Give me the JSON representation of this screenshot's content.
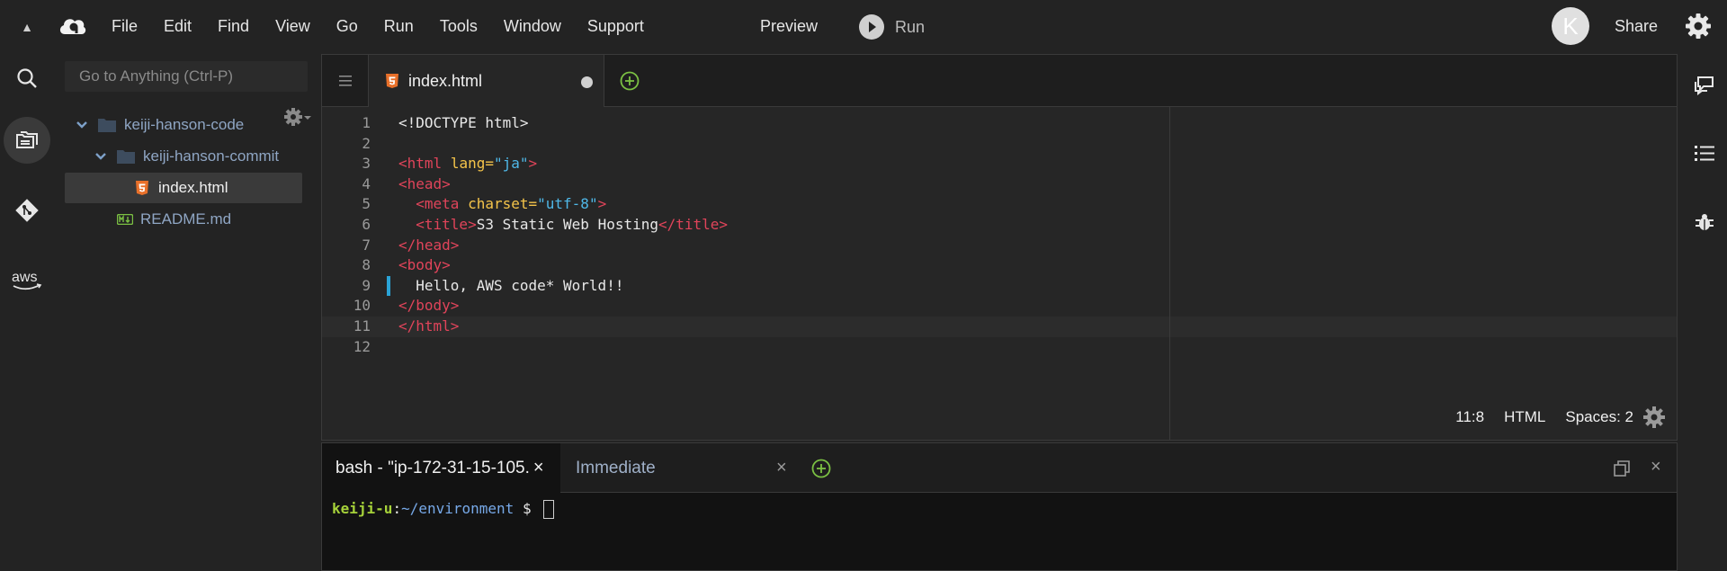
{
  "menubar": {
    "items": [
      "File",
      "Edit",
      "Find",
      "View",
      "Go",
      "Run",
      "Tools",
      "Window",
      "Support"
    ],
    "preview_label": "Preview",
    "run_label": "Run",
    "avatar_initial": "K",
    "share_label": "Share"
  },
  "tree": {
    "search_placeholder": "Go to Anything (Ctrl-P)",
    "nodes": [
      {
        "label": "keiji-hanson-code"
      },
      {
        "label": "keiji-hanson-commit"
      },
      {
        "label": "index.html"
      },
      {
        "label": "README.md"
      }
    ]
  },
  "editor": {
    "tab_name": "index.html",
    "status": {
      "position": "11:8",
      "mode": "HTML",
      "spaces": "Spaces: 2"
    },
    "lines": [
      "1",
      "2",
      "3",
      "4",
      "5",
      "6",
      "7",
      "8",
      "9",
      "10",
      "11",
      "12"
    ],
    "code": {
      "doctype": "<!DOCTYPE html>",
      "html_open": "<html",
      "lang_attr": "lang=",
      "lang_val": "\"ja\"",
      "gt": ">",
      "head_open": "<head>",
      "meta_open": "<meta",
      "charset_attr": "charset=",
      "charset_val": "\"utf-8\"",
      "title_open": "<title>",
      "title_text": "S3 Static Web Hosting",
      "title_close": "</title>",
      "head_close": "</head>",
      "body_open": "<body>",
      "body_text": "Hello, AWS code* World!!",
      "body_close": "</body>",
      "html_close": "</html>"
    }
  },
  "terminal": {
    "tab1": "bash - \"ip-172-31-15-105.",
    "tab1_close": "×",
    "tab2": "Immediate",
    "tab2_close": "×",
    "close_panel": "×",
    "user": "keiji-u",
    "colon": ":",
    "path": "~/environment",
    "dollar": " $ "
  },
  "colors": {
    "accent_green": "#7bc043",
    "html5_orange": "#e8702a",
    "tag_red": "#e0445a",
    "attr_yellow": "#f5c44a",
    "string_blue": "#4fb8e8"
  }
}
